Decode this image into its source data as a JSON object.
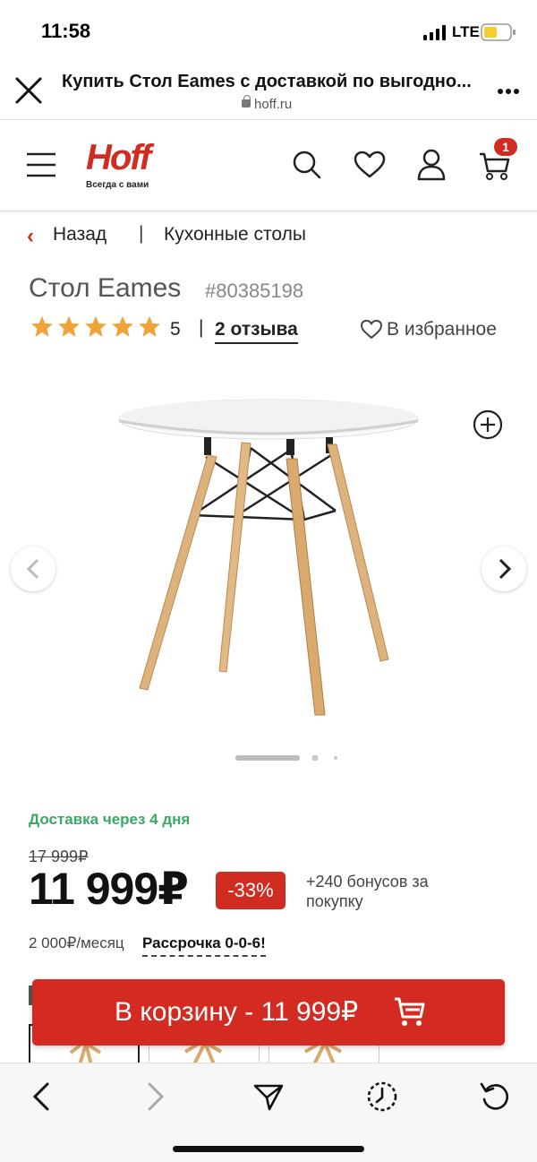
{
  "status_bar": {
    "time": "11:58",
    "network": "LTE"
  },
  "browser": {
    "page_title": "Купить Стол Eames с доставкой по выгодно...",
    "domain": "hoff.ru"
  },
  "site_header": {
    "logo_text": "Hoff",
    "logo_tagline": "Всегда с вами",
    "cart_count": "1",
    "brand_color": "#d12c21"
  },
  "breadcrumb": {
    "back_chevron": "‹",
    "back_label": "Назад",
    "separator": "|",
    "category": "Кухонные столы"
  },
  "product": {
    "title": "Стол Eames",
    "sku": "#80385198",
    "rating": "5",
    "rating_separator": "|",
    "stars_filled": 5,
    "reviews_label": "2 отзыва",
    "favorite_label": "В избранное"
  },
  "gallery": {
    "image_count": 3,
    "active_index": 0
  },
  "delivery": {
    "text": "Доставка через 4 дня",
    "color": "#3aa866"
  },
  "pricing": {
    "old_price": "17 999₽",
    "price": "11 999₽",
    "discount": "-33%",
    "bonus": "+240 бонусов за покупку",
    "monthly": "2 000₽/месяц",
    "installment": "Рассрочка 0-0-6!"
  },
  "cart_button": {
    "label": "В корзину - 11 999₽"
  }
}
